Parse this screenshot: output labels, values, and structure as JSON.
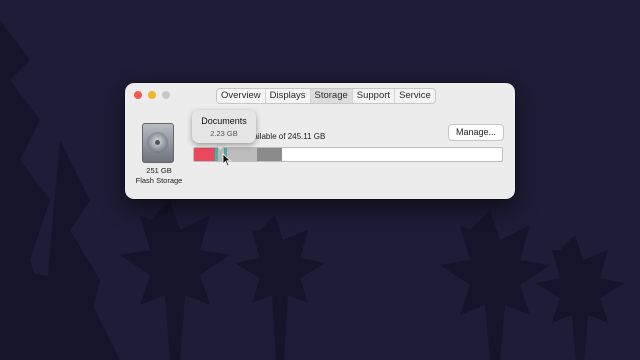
{
  "tabs": [
    {
      "label": "Overview"
    },
    {
      "label": "Displays"
    },
    {
      "label": "Storage"
    },
    {
      "label": "Support"
    },
    {
      "label": "Service"
    }
  ],
  "selected_tab": "Storage",
  "disk": {
    "capacity": "251 GB",
    "type": "Flash Storage"
  },
  "storage": {
    "status_text": "available of 245.11 GB",
    "manage_label": "Manage...",
    "tooltip_title": "Documents",
    "tooltip_size": "2.23 GB"
  },
  "storage_bar_segments": [
    {
      "category": "apps",
      "fraction": 0.069,
      "color": "#e8475e"
    },
    {
      "category": "documents",
      "fraction": 0.008,
      "color": "#37b9a6"
    },
    {
      "category": "other-light",
      "fraction": 0.021,
      "color": "#b7b7b7"
    },
    {
      "category": "documents-highlight",
      "fraction": 0.009,
      "color": "#5aa0a0"
    },
    {
      "category": "system",
      "fraction": 0.098,
      "color": "#bcbcbc"
    },
    {
      "category": "other",
      "fraction": 0.081,
      "color": "#8b8b8b"
    }
  ],
  "colors": {
    "desktop": "#1e1c36",
    "window": "#ececec"
  }
}
